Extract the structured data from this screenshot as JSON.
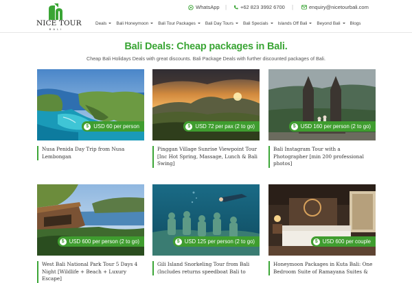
{
  "logo": {
    "name": "NICE TOUR",
    "sub": "BALI"
  },
  "topbar": {
    "whatsapp": "WhatsApp",
    "phone": "+62 823 3992 6700",
    "email": "enquiry@nicetourbali.com",
    "separator": "|"
  },
  "nav": [
    {
      "label": "Deals",
      "dropdown": true
    },
    {
      "label": "Bali Honeymoon",
      "dropdown": true
    },
    {
      "label": "Bali Tour Packages",
      "dropdown": true
    },
    {
      "label": "Bali Day Tours",
      "dropdown": true
    },
    {
      "label": "Bali Specials",
      "dropdown": true
    },
    {
      "label": "Islands Off Bali",
      "dropdown": true
    },
    {
      "label": "Beyond Bali",
      "dropdown": true
    },
    {
      "label": "Blogs",
      "dropdown": false
    }
  ],
  "page": {
    "title": "Bali Deals: Cheap packages in Bali.",
    "subtitle": "Cheap Bali Holidays Deals with great discounts. Bali Package Deals with further discounted packages of Bali."
  },
  "cards": [
    {
      "price": "USD 60 per person",
      "title": "Nusa Penida Day Trip from Nusa Lembongan"
    },
    {
      "price": "USD 72 per pax (2 to go)",
      "title": "Pinggan Village Sunrise Viewpoint Tour [Inc Hot Spring, Massage, Lunch & Bali Swing]"
    },
    {
      "price": "USD 160 per person (2 to go)",
      "title": "Bali Instagram Tour with a Photographer [min 200 professional photos]"
    },
    {
      "price": "USD 600 per person (2 to go)",
      "title": "West Bali National Park Tour 5 Days 4 Night [Wildlife + Beach + Luxury Escape]"
    },
    {
      "price": "USD 125 per person (2 to go)",
      "title": "Gili Island Snorkeling Tour from Bali (Includes returns speedboat Bali to"
    },
    {
      "price": "USD 600 per couple",
      "title": "Honeymoon Packages in Kuta Bali: One Bedroom Suite of Ramayana Suites &"
    }
  ],
  "colors": {
    "accent": "#3aa535",
    "badge": "#3f9d2f"
  }
}
